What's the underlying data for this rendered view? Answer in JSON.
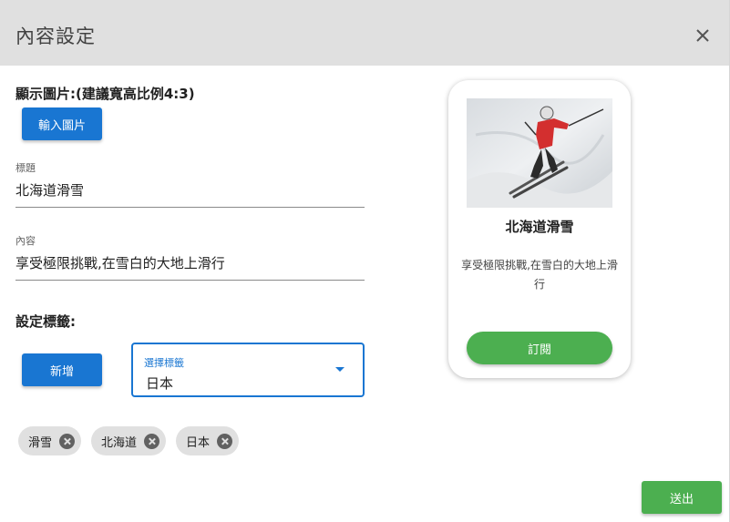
{
  "dialog": {
    "title": "內容設定",
    "close_icon": "close-icon"
  },
  "image_section": {
    "label": "顯示圖片:(建議寬高比例4:3)",
    "upload_button": "輸入圖片"
  },
  "form": {
    "title_field": {
      "label": "標題",
      "value": "北海道滑雪"
    },
    "content_field": {
      "label": "內容",
      "value": "享受極限挑戰,在雪白的大地上滑行"
    }
  },
  "tags_section": {
    "label": "設定標籤:",
    "add_button": "新增",
    "select": {
      "label": "選擇標籤",
      "value": "日本"
    },
    "chips": [
      {
        "label": "滑雪"
      },
      {
        "label": "北海道"
      },
      {
        "label": "日本"
      }
    ]
  },
  "preview_card": {
    "image_icon": "skier-photo",
    "title": "北海道滑雪",
    "text": "享受極限挑戰,在雪白的大地上滑行",
    "subscribe_button": "訂閱"
  },
  "footer": {
    "submit_button": "送出"
  },
  "colors": {
    "header_bg": "#e0e0e0",
    "primary_blue": "#1976d2",
    "accent_green": "#4caf50",
    "chip_bg": "#e0e0e0"
  }
}
